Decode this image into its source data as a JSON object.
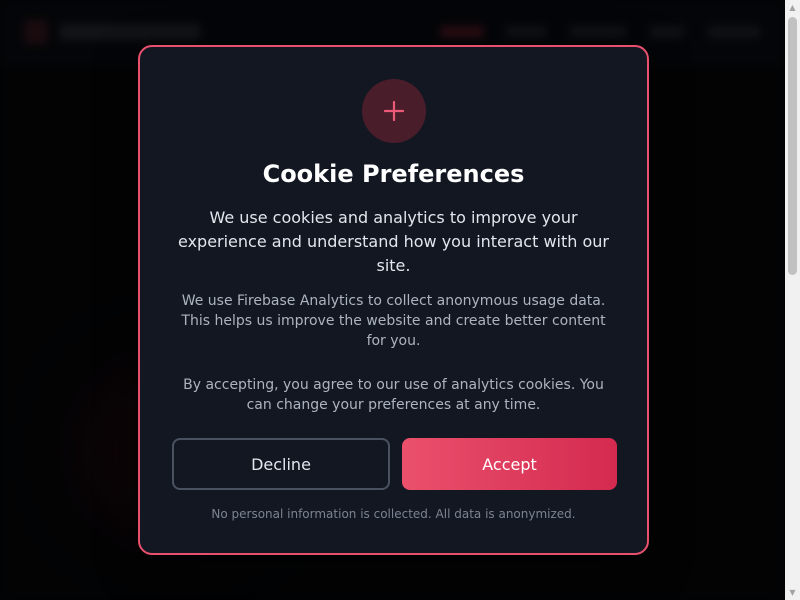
{
  "cookie_modal": {
    "icon": "plus-icon",
    "title": "Cookie Preferences",
    "lead": "We use cookies and analytics to improve your experience and understand how you interact with our site.",
    "detail": "We use Firebase Analytics to collect anonymous usage data. This helps us improve the website and create better content for you.",
    "consent": "By accepting, you agree to our use of analytics cookies. You can change your preferences at any time.",
    "decline_label": "Decline",
    "accept_label": "Accept",
    "footnote": "No personal information is collected. All data is anonymized."
  },
  "colors": {
    "accent": "#e8506d",
    "accent_dark": "#d42a4f",
    "modal_background": "#121722",
    "page_background": "#050608"
  }
}
